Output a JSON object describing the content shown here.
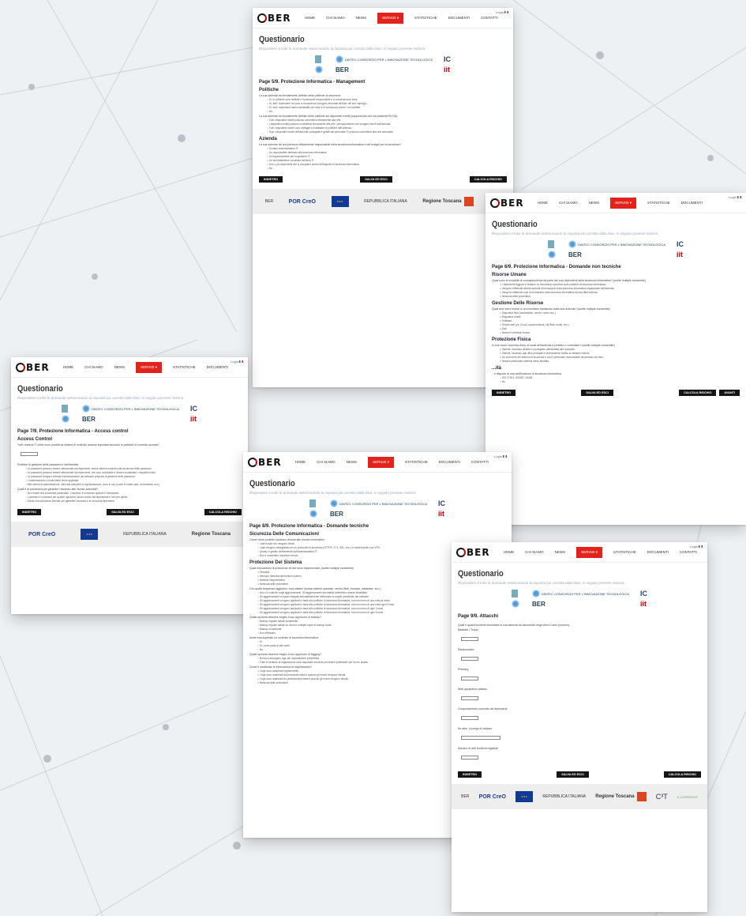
{
  "login": "Login",
  "nav": [
    "HOME",
    "CHI SIAMO",
    "NEWS",
    "SERVIZI ▾",
    "STATISTICHE",
    "DOCUMENTI",
    "CONTATTI"
  ],
  "brand": "BER",
  "title": "Questionario",
  "subtitle": "Rispondere a tutte le domande selezionando la risposta più corretta dalla lista. In seguito premete Submit.",
  "partners": [
    "DINTEC CONSORZIO PER L'INNOVAZIONE TECNOLOGICA",
    "IC",
    "iit"
  ],
  "buttons": {
    "back": "INDIETRO",
    "save": "SALVA ED ESCI",
    "calc": "CALCOLA RISCHIO",
    "next": "AVANTI"
  },
  "footer": {
    "por": "POR CreO",
    "italia": "REPUBBLICA ITALIANA",
    "toscana": "Regione Toscana",
    "c3t": "C³T",
    "corridor": "E-CORRIDOR"
  },
  "pages": {
    "p5": {
      "head": "Page 5/9. Protezione Informatica - Management",
      "s1": "Politiche",
      "q1": "La sua azienda ha formalmente definito delle politiche di sicurezza:",
      "q1o": [
        "Sì, le politiche sono definite e il personale responsabile è a conoscenza di esse.",
        "Sì, tutti i dipendenti ne sono a conoscenza (vengono informati all'inizio del loro impiego).",
        "Sì, tutti i dipendenti hanno familiarità con esse e le conoscono anche i non addetti.",
        "No."
      ],
      "q2": "La sua azienda ha formalmente definito delle politiche sui dispositivi mobili (supponendo che sia presente BYOD):",
      "q2o": [
        "Tutti i dispositivi mobili possono connettersi liberamente alla rete.",
        "I dispositivi mobili possono connettersi liberamente alla rete, presupponendo che vengano forniti dall'azienda.",
        "Tutti i dispositivi mobili sono obbligati a soddisfare le politiche dell'azienda.",
        "Solo i dispositivi mobili dell'azienda configurati e gestiti dal personale IT possono connettersi alla rete aziendale."
      ],
      "s2": "Azienda",
      "q3": "La sua azienda ha una persona ufficialmente responsabile della sicurezza informatica e del budget per la sicurezza?",
      "q3o": [
        "Il nostro amministratore IT.",
        "Un responsabile dedicato alla sicurezza informatica.",
        "Un'organizzazione per la gestione IT.",
        "Un amministratore condiviso nell'area IT.",
        "Uno o più dipendenti che si occupano anche dell'aspetto di sicurezza informatica.",
        "No."
      ]
    },
    "p6": {
      "head": "Page 6/9. Protezione Informatica - Domande non tecniche",
      "s1": "Risorse Umane",
      "q1": "Quali sono le modalità di consapevolezza da parte dei suoi dipendenti della sicurezza informatica? (scelte multiple consentite)",
      "q1o": [
        "I dipendenti leggono e firmano un documento specifico sulle politiche di sicurezza informatica.",
        "Vengono effettuate attività speciali di formazione sulla sicurezza informatica organizzate dall'azienda.",
        "Vengono effettuati corsi di formazione sulla sicurezza informatica da una ditta esterna.",
        "Nessuna delle precedenti."
      ],
      "s2": "Gestione Delle Risorse",
      "q2": "Quali beni sono inclusi in un inventario mantenuto dalla sua azienda? (scelte multiple consentite)",
      "q2o": [
        "Dispositivi fisici (workstation, server, router ecc.).",
        "Dispositivi mobili.",
        "Software.",
        "Servizi web (es. Cloud, social network, siti Web, email, ecc.).",
        "Dati.",
        "Nessun inventario tenuto."
      ],
      "s3": "Protezione Fisica",
      "q3": "In che modo l'accesso fisico ai locali dell'azienda è protetto e controllato? (scelte multiple consentite)",
      "q3o": [
        "Sistemi: l'accesso all'area è sorvegliato dall'addetto alla reception.",
        "Sistemi: l'accesso agli uffici principali è severamente vietato ai visitatori esterni.",
        "Un solo bene del sistema di sicurezza e solo il personale responsabile ha accesso ad esso.",
        "Nessun particolare sistema viene adottato."
      ],
      "s4": "...ità",
      "q4": "...o dispone di una certificazione di sicurezza informatica:",
      "q4o": [
        "ISO 27001, ISO/IEC 15408",
        "No."
      ]
    },
    "p7": {
      "head": "Page 7/9. Protezione Informatica - Access control",
      "s1": "Access Control",
      "q1": "Tutti i sistemi IT critici sono protetti da sistemi di controllo accessi impostati secondo le politiche di controllo accessi?",
      "q2": "Politiche di gestione delle password e dell'identità:",
      "q2o": [
        "Le password possono essere selezionate dai dipendenti, senza ulteriori controlli sulla sicurezza delle password.",
        "Le password possono essere selezionate dai dipendenti, ma sono controllate e devono soddisfare i requisiti minimi.",
        "Le password vengono emesse esclusivamente dal software preposto di gestione delle password.",
        "L'autenticazione a multi-fattori viene applicata.",
        "Altri metodi di autenticazione, oltre alla semplice di login/password, sono in uso (come le smart card, la biometria, ecc.)."
      ],
      "q3": "Quali è la procedura per garantire l'accesso alle risorse aziendali?",
      "q3o": [
        "Non esiste una procedura particolare. L'accesso è concesso quando è necessario.",
        "L'accesso è concesso per quanto riguarda il lavoro svolto dal dipendente e non per quello.",
        "Esiste una procedura formale per garantire l'accesso e la revoca ai dipendenti."
      ]
    },
    "p8": {
      "head": "Page 8/9. Protezione Informatica - Domande tecniche",
      "s1": "Sicurezza Delle Comunicazioni",
      "q1": "Come viene protetto l'accesso remoto alle risorse informative:",
      "q1o": [
        "I dati inviati non vengono cifrati.",
        "I dati vengono crittografati con un protocollo di sicurezza (HTTPS, TLS, SSL, ecc.) e inviati tramite una VPN.",
        "Questo è gestito direttamente dall'amministratore IT.",
        "Non è consentito l'accesso remoto."
      ],
      "s2": "Protezione Del Sistema",
      "q2": "Quali meccanismi di protezione di rete sono implementati: (scelte multiple consentite)",
      "q2o": [
        "Firewalls",
        "Intrusion detection/prevention system",
        "Network Segmentation",
        "Nessuna delle precedenti"
      ],
      "q3": "Con quale frequenza aggiorna i suoi sistemi (inclusi sistemi operativi, servizi Web, browser, database, ecc.):",
      "q3o": [
        "Non c'è controllo sugli aggiornamenti. Gli aggiornamenti automatici potrebbero essere disabilitati.",
        "Gli aggiornamenti vengono eseguiti automaticamente utilizzando le regole predefinite del software.",
        "Gli aggiornamenti vengono applicati in base alle politiche di sicurezza informatica, ma non meno di una volta al mese.",
        "Gli aggiornamenti vengono applicati in base alle politiche di sicurezza informatica, ma non meno di una volta ogni 6 mesi.",
        "Gli aggiornamenti vengono applicati in base alle politiche di sicurezza informatica, ma non meno di ogni 3 mesi.",
        "Gli aggiornamenti vengono applicati in base alle politiche di sicurezza informatica, ma non meno di ogni 6 mesi."
      ],
      "q4": "Quale opzione descrive meglio il suo approccio di backup?",
      "q4o": [
        "Backup regolari salvati localmente.",
        "Backup regolari salvati su cloud e multiple copie di backup locali.",
        "Backup occasionali.",
        "Non effettuato."
      ],
      "q5": "Avete mai superato un controllo di sicurezza informatica:",
      "q5o": [
        "Sì.",
        "Sì, come parte di altri audit",
        "No."
      ],
      "q6": "Quale opzione descrive meglio il suo approccio di logging?",
      "q6o": [
        "Nel tuoi raccolgono logs per impostazione predefinita.",
        "Tutte le strutture di registrazione sono impostate secondo procedure predefinite per la loro analisi."
      ],
      "q7": "Come è analizzato le informazioni di registrazione?",
      "q7o": [
        "I logs sono analizzati regolarmente.",
        "I logs sono analizzati dal personale interno quando gli eventi vengono rilevati.",
        "I logs sono analizzati da professionisti esterni quando gli eventi vengono rilevati.",
        "Nessuna delle precedenti"
      ]
    },
    "p9": {
      "head": "Page 9/9. Attacchi",
      "q0": "Quali e quanti incidenti informatici la sua azienda ha riscontrato negli ultimi 3 anni (numero):",
      "fields": [
        "Malware / Trojan",
        "Ransomware",
        "Phishing",
        "Web application attacks",
        "Comportamento scorretto dei dipendenti",
        "Se altro, si prega di indicare",
        "Numero di altri incidenti registrati"
      ]
    }
  }
}
